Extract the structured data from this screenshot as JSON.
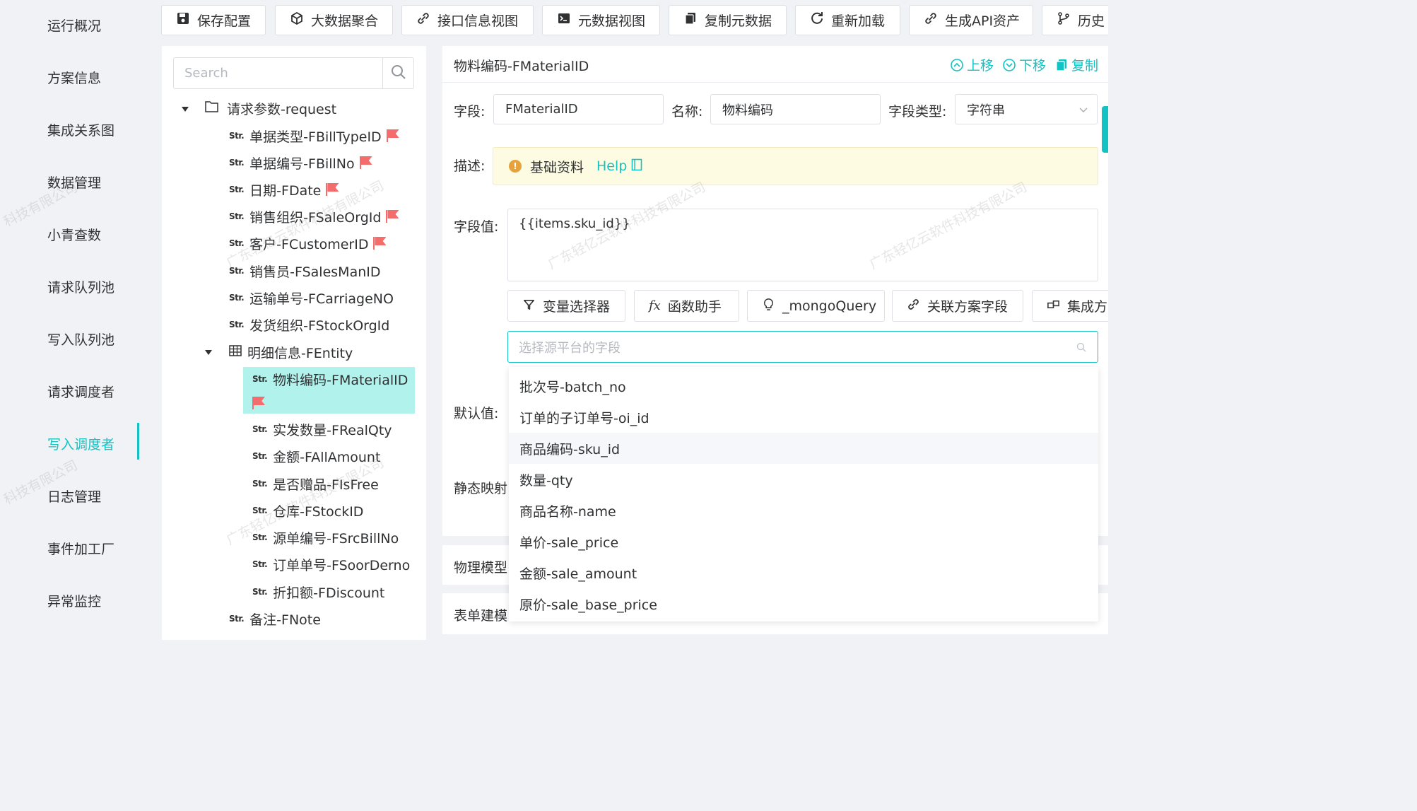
{
  "sidebar": {
    "items": [
      {
        "label": "运行概况"
      },
      {
        "label": "方案信息"
      },
      {
        "label": "集成关系图"
      },
      {
        "label": "数据管理"
      },
      {
        "label": "小青查数"
      },
      {
        "label": "请求队列池"
      },
      {
        "label": "写入队列池"
      },
      {
        "label": "请求调度者"
      },
      {
        "label": "写入调度者"
      },
      {
        "label": "日志管理"
      },
      {
        "label": "事件加工厂"
      },
      {
        "label": "异常监控"
      }
    ],
    "active": "写入调度者"
  },
  "toolbar": {
    "buttons": [
      {
        "label": "保存配置",
        "icon": "save-icon"
      },
      {
        "label": "大数据聚合",
        "icon": "cube-icon"
      },
      {
        "label": "接口信息视图",
        "icon": "link-icon"
      },
      {
        "label": "元数据视图",
        "icon": "terminal-icon"
      },
      {
        "label": "复制元数据",
        "icon": "copy-icon"
      },
      {
        "label": "重新加载",
        "icon": "reload-icon"
      },
      {
        "label": "生成API资产",
        "icon": "link-icon"
      },
      {
        "label": "历史",
        "icon": "branch-icon"
      }
    ]
  },
  "tree": {
    "search_placeholder": "Search",
    "str_tag": "Str.",
    "root_label": "请求参数-request",
    "nodes": [
      {
        "label": "单据类型-FBillTypeID",
        "flag": true
      },
      {
        "label": "单据编号-FBillNo",
        "flag": true
      },
      {
        "label": "日期-FDate",
        "flag": true
      },
      {
        "label": "销售组织-FSaleOrgId",
        "flag": true
      },
      {
        "label": "客户-FCustomerID",
        "flag": true
      },
      {
        "label": "销售员-FSalesManID",
        "flag": false
      },
      {
        "label": "运输单号-FCarriageNO",
        "flag": false
      },
      {
        "label": "发货组织-FStockOrgId",
        "flag": false
      }
    ],
    "entity_label": "明细信息-FEntity",
    "children": [
      {
        "label": "物料编码-FMaterialID",
        "flag": true,
        "selected": true
      },
      {
        "label": "实发数量-FRealQty"
      },
      {
        "label": "金额-FAllAmount"
      },
      {
        "label": "是否赠品-FIsFree"
      },
      {
        "label": "仓库-FStockID"
      },
      {
        "label": "源单编号-FSrcBillNo"
      },
      {
        "label": "订单单号-FSoorDerno"
      },
      {
        "label": "折扣额-FDiscount"
      }
    ],
    "note_label": "备注-FNote"
  },
  "form": {
    "title": "物料编码-FMaterialID",
    "actions": {
      "up": "上移",
      "down": "下移",
      "copy": "复制"
    },
    "field_label": "字段:",
    "field_value": "FMaterialID",
    "name_label": "名称:",
    "name_value": "物料编码",
    "type_label": "字段类型:",
    "type_value": "字符串",
    "desc_label": "描述:",
    "desc_text": "基础资料",
    "help_label": "Help",
    "value_label": "字段值:",
    "value_text": "{{items.sku_id}}",
    "helper_buttons": [
      {
        "label": "变量选择器",
        "icon": "filter-icon"
      },
      {
        "label": "函数助手",
        "icon": "function-icon"
      },
      {
        "label": "_mongoQuery",
        "icon": "bulb-icon"
      },
      {
        "label": "关联方案字段",
        "icon": "link-icon"
      },
      {
        "label": "集成方",
        "icon": "layers-icon"
      }
    ],
    "source_placeholder": "选择源平台的字段",
    "default_label": "默认值:",
    "static_label": "静态映射"
  },
  "sections": {
    "physical_model": "物理模型",
    "form_model": "表单建模"
  },
  "dropdown": {
    "options": [
      "批次号-batch_no",
      "订单的子订单号-oi_id",
      "商品编码-sku_id",
      "数量-qty",
      "商品名称-name",
      "单价-sale_price",
      "金额-sale_amount",
      "原价-sale_base_price"
    ],
    "hovered": "商品编码-sku_id"
  },
  "watermark": {
    "text": "广东轻亿云软件科技有限公司",
    "short": "科技有限公司"
  },
  "colors": {
    "accent": "#13c2c2",
    "flag": "#f56c6c",
    "selected_bg": "#b2f2ec",
    "alert_bg": "#fdfce3"
  }
}
